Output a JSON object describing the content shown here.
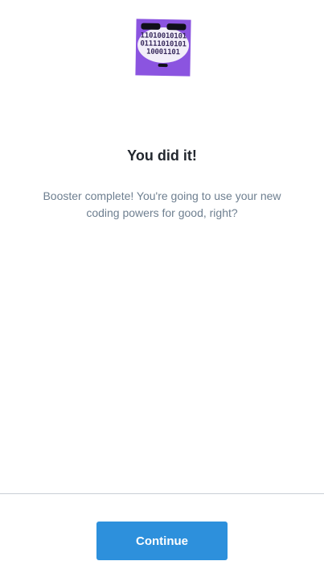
{
  "completion": {
    "badge": {
      "icon": "binary-robot-badge-icon",
      "code_lines": [
        "11010010101",
        "01111010101",
        "10001101"
      ],
      "color": "#8b54e0"
    },
    "title": "You did it!",
    "message": "Booster complete! You're going to use your new coding powers for good, right?"
  },
  "footer": {
    "continue_label": "Continue",
    "button_color": "#2d90dc"
  }
}
